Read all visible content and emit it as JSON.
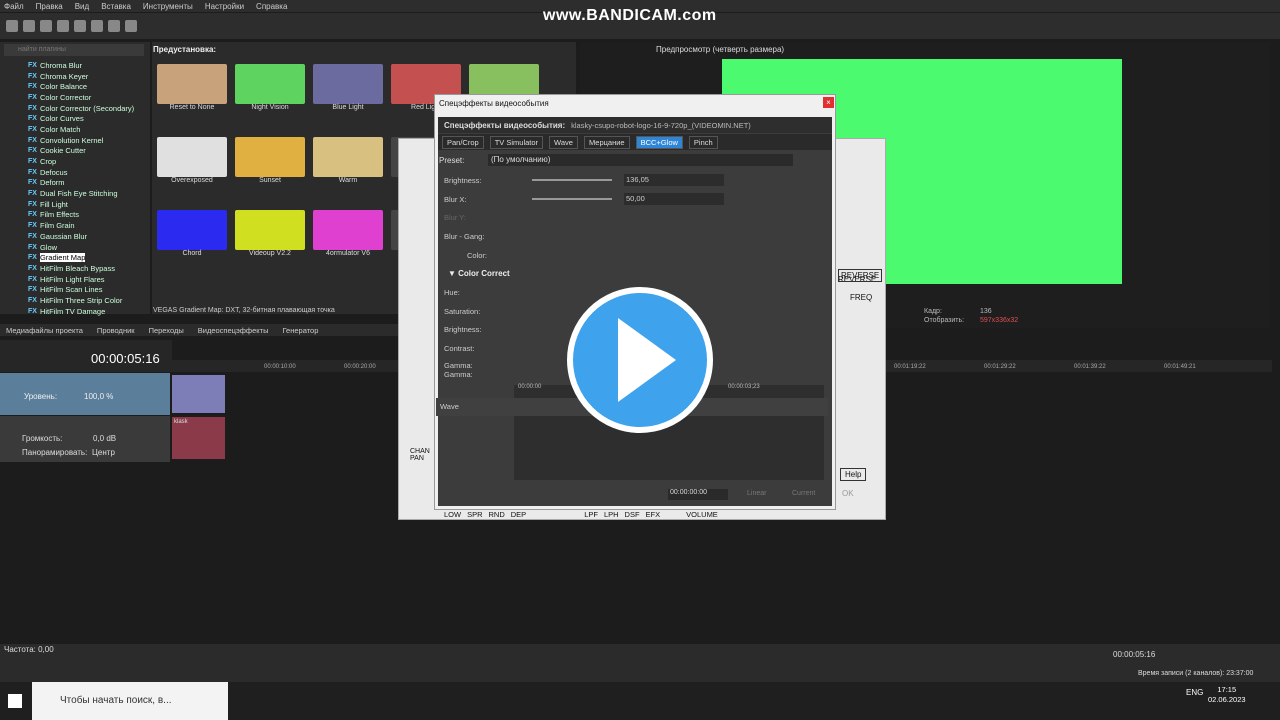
{
  "menu": [
    "Файл",
    "Правка",
    "Вид",
    "Вставка",
    "Инструменты",
    "Настройки",
    "Справка"
  ],
  "watermark": "www.BANDICAM.com",
  "plugins": {
    "search_placeholder": "найти плагины",
    "items": [
      "Chroma Blur",
      "Chroma Keyer",
      "Color Balance",
      "Color Corrector",
      "Color Corrector (Secondary)",
      "Color Curves",
      "Color Match",
      "Convolution Kernel",
      "Cookie Cutter",
      "Crop",
      "Defocus",
      "Deform",
      "Dual Fish Eye Stitching",
      "Fill Light",
      "Film Effects",
      "Film Grain",
      "Gaussian Blur",
      "Glow",
      "Gradient Map",
      "HitFilm Bleach Bypass",
      "HitFilm Light Flares",
      "HitFilm Scan Lines",
      "HitFilm Three Strip Color",
      "HitFilm TV Damage"
    ],
    "selected_index": 18,
    "badge": "FX"
  },
  "presets": {
    "title": "Предустановка:",
    "rows": [
      [
        "Reset to None",
        "Night Vision",
        "Blue Light",
        "Red Light",
        ""
      ],
      [
        "Overexposed",
        "Sunset",
        "Warm",
        "",
        ""
      ],
      [
        "Chord",
        "Videoup V2.2",
        "4ormulator V6",
        "",
        ""
      ]
    ],
    "colors": [
      "#c8a27a",
      "#5fd35f",
      "#6b6ba0",
      "#c45050",
      "#88c060",
      "#e0e0e0",
      "#e0b040",
      "#d8c080",
      "#444",
      "#444",
      "#2a2af0",
      "#d0e020",
      "#e040d0",
      "#444",
      "#444"
    ]
  },
  "preview": {
    "label": "Предпросмотр (четверть размера)",
    "frame_label": "Кадр:",
    "frame_value": "136",
    "display_label": "Отобразить:",
    "display_value": "597x336x32"
  },
  "status_line": "VEGAS Gradient Map: DXT, 32-битная плавающая точка",
  "tabs": [
    "Медиафайлы проекта",
    "Проводник",
    "Переходы",
    "Видеоспецэффекты",
    "Генератор"
  ],
  "timeline": {
    "timecode": "00:00:05:16",
    "track1_label": "Уровень:",
    "track1_value": "100,0 %",
    "track2_vol_label": "Громкость:",
    "track2_vol_value": "0,0 dB",
    "track2_pan_label": "Панорамировать:",
    "track2_pan_value": "Центр",
    "clip_name": "klask",
    "marks": [
      "00:00:10:00",
      "00:00:20:00",
      "00:01:19:22",
      "00:01:29:22",
      "00:01:39:22",
      "00:01:49:21"
    ]
  },
  "rate": {
    "label": "Частота: 0,00"
  },
  "record_time": "Время записи (2 каналов): 23:37:00",
  "end_timecode": "00:00:05:16",
  "dialog": {
    "title": "Спецэффекты видеособытия",
    "fx_label": "Спецэффекты видеособытия:",
    "file": "klasky-csupo-robot-logo-16-9-720p_(VIDEOMIN.NET)",
    "chain": [
      "Pan/Crop",
      "TV Simulator",
      "Wave",
      "Мерцание",
      "BCC+Glow",
      "Pinch"
    ],
    "preset_label": "Preset:",
    "preset_value": "(По умолчанию)",
    "params": [
      {
        "name": "Brightness:",
        "value": "136,05"
      },
      {
        "name": "Blur X:",
        "value": "50,00"
      },
      {
        "name": "Blur Y:",
        "value": ""
      },
      {
        "name": "Blur - Gang:",
        "value": ""
      },
      {
        "name": "Color:",
        "value": ""
      }
    ],
    "section": "Color Correct",
    "cc_params": [
      "Hue:",
      "Saturation:",
      "Brightness:",
      "Contrast:",
      "Gamma: Gamma:"
    ],
    "track": "Wave",
    "kf_times": [
      "00:00:00",
      "00:00:03;23"
    ],
    "kf_time": "00:00:00:00",
    "btn_linear": "Linear",
    "btn_current": "Current"
  },
  "bottom_labels": [
    "LOW",
    "SPR",
    "RND",
    "DEP",
    "LPF",
    "LPH",
    "DSF",
    "EFX",
    "VOLUME"
  ],
  "side_labels": {
    "reverse": "REVERSE",
    "freq": "FREQ",
    "help": "Help",
    "ok": "OK",
    "chan_pan": "CHAN PAN"
  },
  "taskbar": {
    "search": "Чтобы начать поиск, в...",
    "lang": "ENG",
    "time": "17:15",
    "date": "02.06.2023"
  }
}
